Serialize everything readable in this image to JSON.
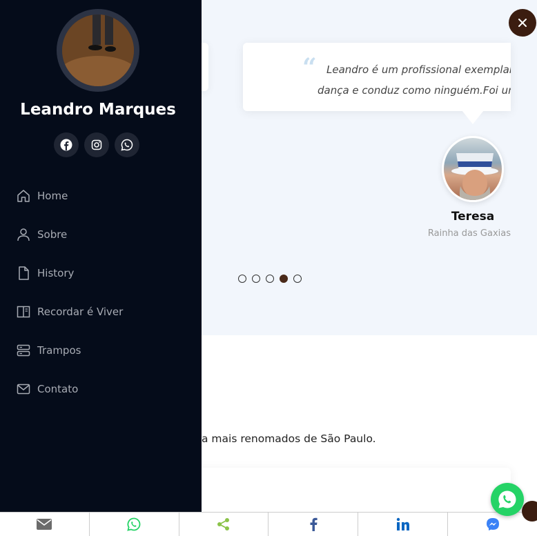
{
  "sidebar": {
    "profile_name": "Leandro Marques",
    "socials": [
      "facebook-icon",
      "instagram-icon",
      "whatsapp-icon"
    ],
    "items": [
      {
        "label": "Home",
        "icon": "home-icon"
      },
      {
        "label": "Sobre",
        "icon": "user-icon"
      },
      {
        "label": "History",
        "icon": "file-icon"
      },
      {
        "label": "Recordar é Viver",
        "icon": "book-icon"
      },
      {
        "label": "Trampos",
        "icon": "server-icon"
      },
      {
        "label": "Contato",
        "icon": "mail-icon"
      }
    ]
  },
  "testimonial": {
    "quote_line1": "Leandro é um profissional exemplar...",
    "quote_line2": "dança e conduz como ninguém.Foi um",
    "name": "Teresa",
    "role": "Rainha das Gaxias",
    "dots_total": 5,
    "dots_active": 4
  },
  "about": {
    "text": "de dança mais renomados de São Paulo."
  },
  "sharebar": [
    "email-icon",
    "whatsapp-icon",
    "share-icon",
    "facebook-icon",
    "linkedin-icon",
    "messenger-icon"
  ],
  "colors": {
    "sidebar_bg": "#050c1a",
    "accent_brown": "#3b1d10",
    "whatsapp_green": "#25d366",
    "band_bg": "#f2f6fc"
  }
}
